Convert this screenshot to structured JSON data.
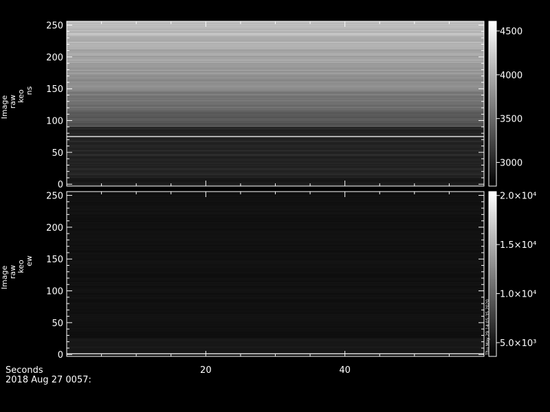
{
  "chart_data": [
    {
      "type": "heatmap",
      "ylabel_lines": [
        "Image",
        "raw",
        "keo",
        "ns"
      ],
      "yticks": [
        0,
        50,
        100,
        150,
        200,
        250
      ],
      "ylim": [
        -3,
        256
      ],
      "xlim": [
        0,
        60
      ],
      "xticks_major": [
        20,
        40
      ],
      "colorbar": {
        "ticks": [
          {
            "value": 3000,
            "label": "3000"
          },
          {
            "value": 3500,
            "label": "3500"
          },
          {
            "value": 4000,
            "label": "4000"
          },
          {
            "value": 4500,
            "label": "4500"
          }
        ],
        "range": [
          2730,
          4610
        ]
      }
    },
    {
      "type": "heatmap",
      "ylabel_lines": [
        "Image",
        "raw",
        "keo",
        "ew"
      ],
      "yticks": [
        0,
        50,
        100,
        150,
        200,
        250
      ],
      "ylim": [
        -3,
        256
      ],
      "xlim": [
        0,
        60
      ],
      "xticks_major": [
        20,
        40
      ],
      "colorbar": {
        "ticks": [
          {
            "value": 5000,
            "label": "5.0×10³"
          },
          {
            "value": 10000,
            "label": "1.0×10⁴"
          },
          {
            "value": 15000,
            "label": "1.5×10⁴"
          },
          {
            "value": 20000,
            "label": "2.0×10⁴"
          }
        ],
        "range": [
          3600,
          20400
        ]
      },
      "side_note": "Thu May 29 14:05:35 2020"
    }
  ],
  "xaxis": {
    "label": "Seconds",
    "ticks": [
      {
        "value": 20,
        "label": "20"
      },
      {
        "value": 40,
        "label": "40"
      }
    ],
    "date": "2018 Aug 27 0057:"
  }
}
